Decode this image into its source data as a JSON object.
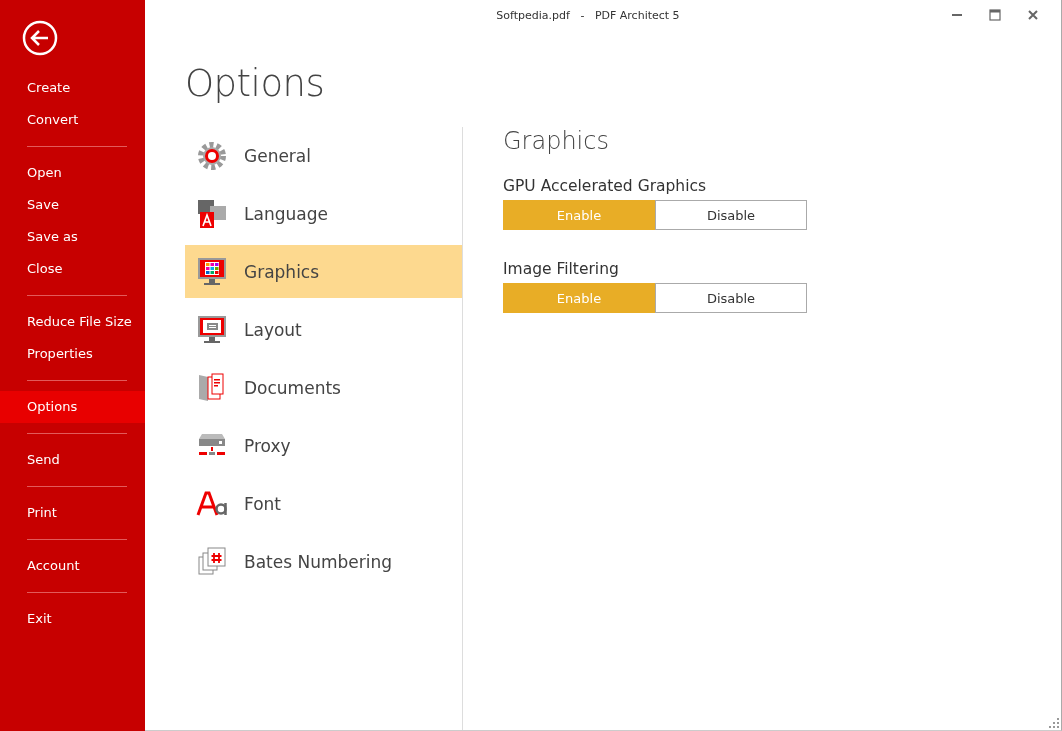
{
  "window": {
    "title": "Softpedia.pdf   -   PDF Architect 5"
  },
  "sidebar": {
    "groups": [
      {
        "items": [
          {
            "label": "Create",
            "selected": false
          },
          {
            "label": "Convert",
            "selected": false
          }
        ]
      },
      {
        "items": [
          {
            "label": "Open",
            "selected": false
          },
          {
            "label": "Save",
            "selected": false
          },
          {
            "label": "Save as",
            "selected": false
          },
          {
            "label": "Close",
            "selected": false
          }
        ]
      },
      {
        "items": [
          {
            "label": "Reduce File Size",
            "selected": false
          },
          {
            "label": "Properties",
            "selected": false
          }
        ]
      },
      {
        "items": [
          {
            "label": "Options",
            "selected": true
          }
        ]
      },
      {
        "items": [
          {
            "label": "Send",
            "selected": false
          }
        ]
      },
      {
        "items": [
          {
            "label": "Print",
            "selected": false
          }
        ]
      },
      {
        "items": [
          {
            "label": "Account",
            "selected": false
          }
        ]
      },
      {
        "items": [
          {
            "label": "Exit",
            "selected": false
          }
        ]
      }
    ]
  },
  "page_title": "Options",
  "categories": [
    {
      "label": "General",
      "kind": "gear",
      "selected": false
    },
    {
      "label": "Language",
      "kind": "language",
      "selected": false
    },
    {
      "label": "Graphics",
      "kind": "monitor-grid",
      "selected": true
    },
    {
      "label": "Layout",
      "kind": "monitor-doc",
      "selected": false
    },
    {
      "label": "Documents",
      "kind": "documents",
      "selected": false
    },
    {
      "label": "Proxy",
      "kind": "proxy",
      "selected": false
    },
    {
      "label": "Font",
      "kind": "font",
      "selected": false
    },
    {
      "label": "Bates Numbering",
      "kind": "bates",
      "selected": false
    }
  ],
  "panel": {
    "title": "Graphics",
    "settings": [
      {
        "label": "GPU Accelerated Graphics",
        "options": [
          {
            "label": "Enable",
            "selected": true
          },
          {
            "label": "Disable",
            "selected": false
          }
        ]
      },
      {
        "label": "Image Filtering",
        "options": [
          {
            "label": "Enable",
            "selected": true
          },
          {
            "label": "Disable",
            "selected": false
          }
        ]
      }
    ]
  }
}
